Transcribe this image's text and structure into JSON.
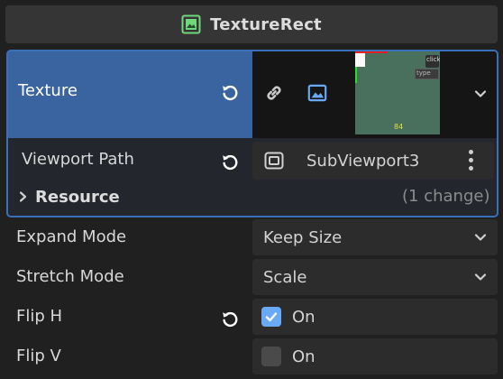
{
  "header": {
    "title": "TextureRect",
    "icon": "texture-rect-icon",
    "icon_color": "#6fd87a"
  },
  "texture": {
    "label": "Texture",
    "preview": {
      "click_label": "click",
      "type_label": "type",
      "numbers": "84"
    }
  },
  "viewport_path": {
    "label": "Viewport Path",
    "value": "SubViewport3"
  },
  "resource": {
    "label": "Resource",
    "changes": "(1 change)"
  },
  "expand_mode": {
    "label": "Expand Mode",
    "value": "Keep Size"
  },
  "stretch_mode": {
    "label": "Stretch Mode",
    "value": "Scale"
  },
  "flip_h": {
    "label": "Flip H",
    "checked": true,
    "on_label": "On"
  },
  "flip_v": {
    "label": "Flip V",
    "checked": false,
    "on_label": "On"
  },
  "colors": {
    "accent": "#3b6fb8",
    "selected_row": "#3a64a0",
    "checkbox_on": "#6aa9f5"
  }
}
